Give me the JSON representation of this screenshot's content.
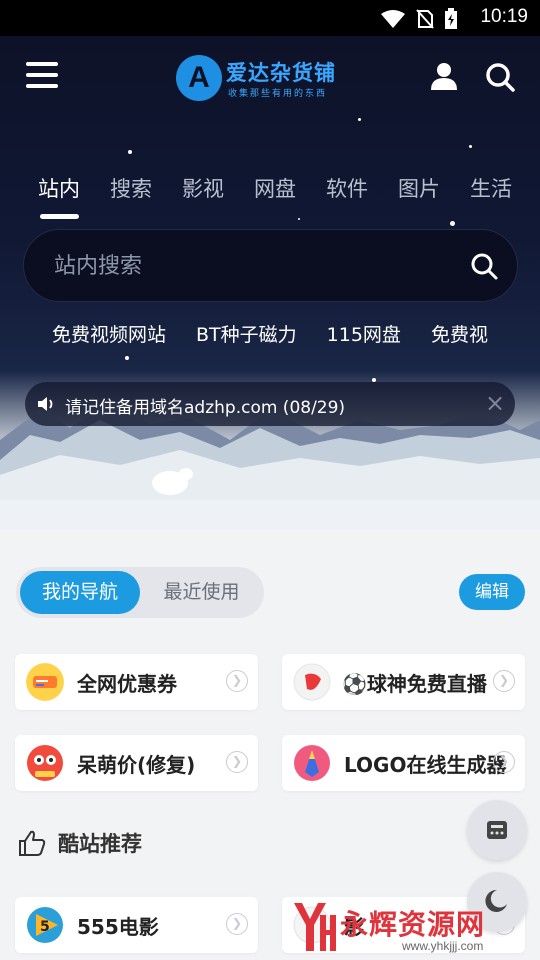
{
  "status_bar": {
    "time": "10:19"
  },
  "header": {
    "logo_letter": "A",
    "logo_title": "爱达杂货铺",
    "logo_subtitle": "收集那些有用的东西"
  },
  "tabs": [
    {
      "label": "站内",
      "active": true
    },
    {
      "label": "搜索"
    },
    {
      "label": "影视"
    },
    {
      "label": "网盘"
    },
    {
      "label": "软件"
    },
    {
      "label": "图片"
    },
    {
      "label": "生活"
    }
  ],
  "search": {
    "placeholder": "站内搜索"
  },
  "quick_links": [
    "免费视频网站",
    "BT种子磁力",
    "115网盘",
    "免费视"
  ],
  "notice": {
    "text": "请记住备用域名adzhp.com (08/29)",
    "close": "×"
  },
  "nav_tabs": {
    "mine": "我的导航",
    "recent": "最近使用",
    "edit": "编辑"
  },
  "nav_items": [
    {
      "label": "全网优惠券",
      "icon": "coupon-icon"
    },
    {
      "label": "⚽球神免费直播",
      "icon": "ball-icon"
    },
    {
      "label": "呆萌价(修复)",
      "icon": "mascot-icon"
    },
    {
      "label": "LOGO在线生成器",
      "icon": "pencil-logo-icon"
    }
  ],
  "recommend": {
    "title": "酷站推荐",
    "items": [
      {
        "label": "555电影",
        "icon": "play-icon"
      },
      {
        "label": "影",
        "icon": "film-icon"
      }
    ]
  },
  "watermark": {
    "text": "永辉资源网",
    "url": "www.yhkjjj.com"
  },
  "colors": {
    "accent": "#1c9be0",
    "hero_dark": "#0d1126"
  }
}
